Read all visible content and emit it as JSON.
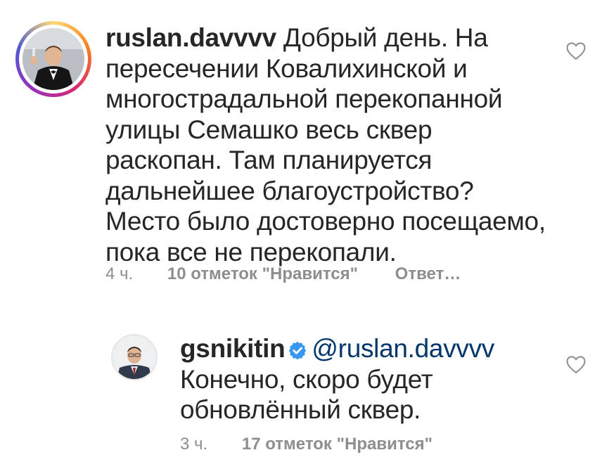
{
  "comments": [
    {
      "username": "ruslan.davvvv",
      "lines": [
        "Добрый день. На",
        "пересечении Ковалихинской и",
        "многострадальной перекопанной",
        "улицы Семашко весь сквер",
        "раскопан. Там планируется",
        "дальнейшее благоустройство?",
        "Место было достоверно посещаемо,",
        "пока все не перекопали."
      ],
      "time": "4 ч.",
      "likes": "10 отметок \"Нравится\"",
      "reply": "Ответ…",
      "has_story_ring": true,
      "icon": "heart-outline-icon"
    },
    {
      "username": "gsnikitin",
      "verified": true,
      "mention": "@ruslan.davvvv",
      "lines": [
        "Конечно, скоро будет",
        "обновлённый сквер."
      ],
      "time": "3 ч.",
      "likes": "17 отметок \"Нравится\"",
      "icon": "heart-outline-icon"
    }
  ],
  "colors": {
    "text": "#262626",
    "secondary": "#8e8e8e",
    "mention": "#00376b",
    "verified": "#3897f0"
  }
}
